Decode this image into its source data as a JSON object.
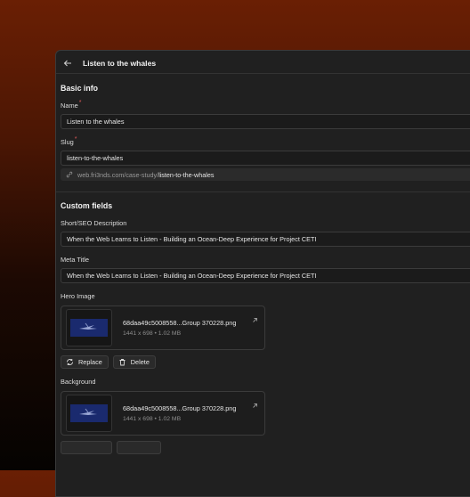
{
  "header": {
    "title": "Listen to the whales"
  },
  "basic_info": {
    "heading": "Basic info",
    "name": {
      "label": "Name",
      "required_mark": "*",
      "value": "Listen to the whales"
    },
    "slug": {
      "label": "Slug",
      "required_mark": "*",
      "value": "listen-to-the-whales",
      "url_prefix": "web.fri3nds.com/case-study/",
      "url_slug": "listen-to-the-whales"
    }
  },
  "custom_fields": {
    "heading": "Custom fields",
    "short_description": {
      "label": "Short/SEO Description",
      "value": "When the Web Learns to Listen - Building an Ocean-Deep Experience for Project CETI"
    },
    "meta_title": {
      "label": "Meta Title",
      "value": "When the Web Learns to Listen - Building an Ocean-Deep Experience for Project CETI"
    },
    "hero_image": {
      "label": "Hero Image",
      "file_name": "68daa49c5008558...Group 370228.png",
      "file_meta": "1441 x 698 • 1.02 MB",
      "replace_label": "Replace",
      "delete_label": "Delete"
    },
    "background": {
      "label": "Background",
      "file_name": "68daa49c5008558...Group 370228.png",
      "file_meta": "1441 x 698 • 1.02 MB"
    }
  },
  "icons": [
    "arrow-left-icon",
    "link-icon",
    "external-link-icon",
    "refresh-icon",
    "trash-icon"
  ]
}
